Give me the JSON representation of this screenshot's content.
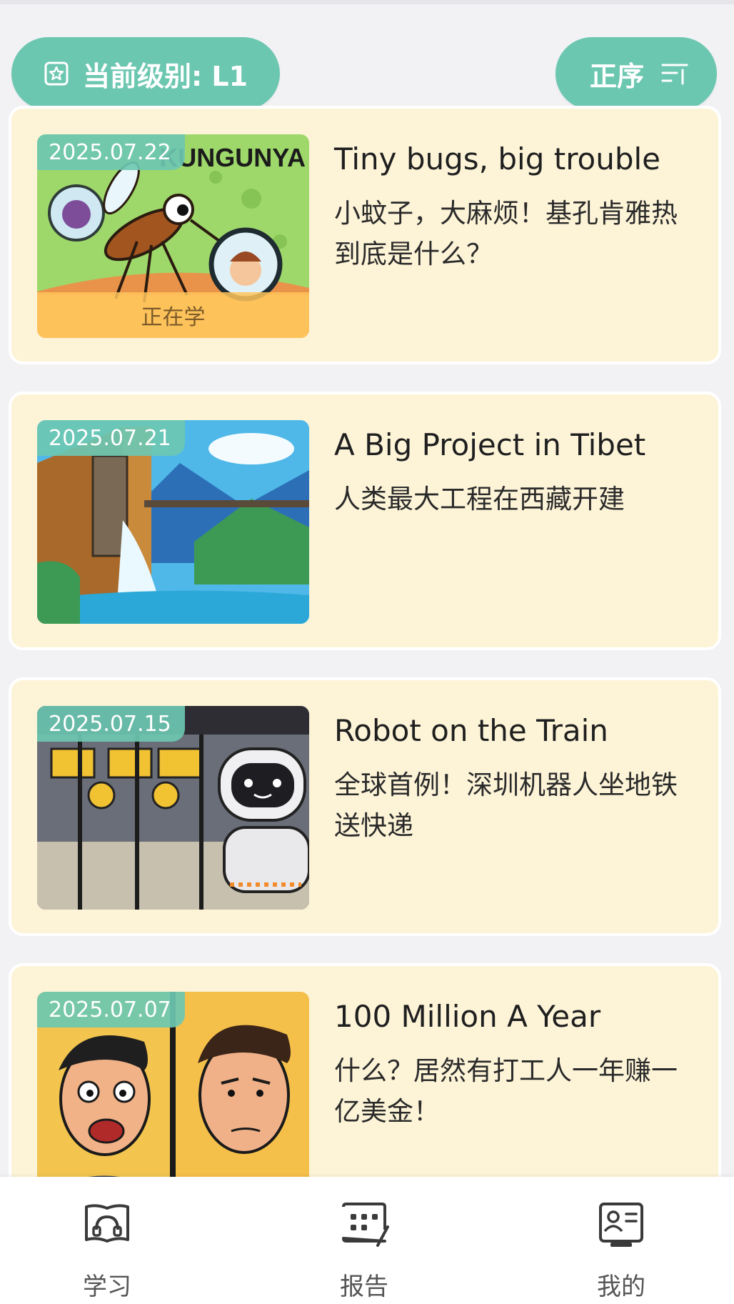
{
  "header": {
    "level_label": "当前级别: L1",
    "sort_label": "正序"
  },
  "articles": [
    {
      "date": "2025.07.22",
      "title_en": "Tiny bugs, big trouble",
      "title_cn": "小蚊子，大麻烦！基孔肯雅热到底是什么？",
      "status": "正在学",
      "thumb_text": "KUNGUNYA"
    },
    {
      "date": "2025.07.21",
      "title_en": "A Big Project in Tibet",
      "title_cn": "人类最大工程在西藏开建"
    },
    {
      "date": "2025.07.15",
      "title_en": "Robot on the Train",
      "title_cn": "全球首例！深圳机器人坐地铁送快递"
    },
    {
      "date": "2025.07.07",
      "title_en": "100 Million A Year",
      "title_cn": "什么？居然有打工人一年赚一亿美金！"
    }
  ],
  "nav": {
    "items": [
      {
        "label": "学习",
        "icon": "headphones-book-icon"
      },
      {
        "label": "报告",
        "icon": "report-grid-icon"
      },
      {
        "label": "我的",
        "icon": "profile-card-icon"
      }
    ]
  },
  "colors": {
    "accent": "#6cc7b1",
    "card_bg": "#fdf4d8",
    "page_bg": "#f2f2f5"
  }
}
